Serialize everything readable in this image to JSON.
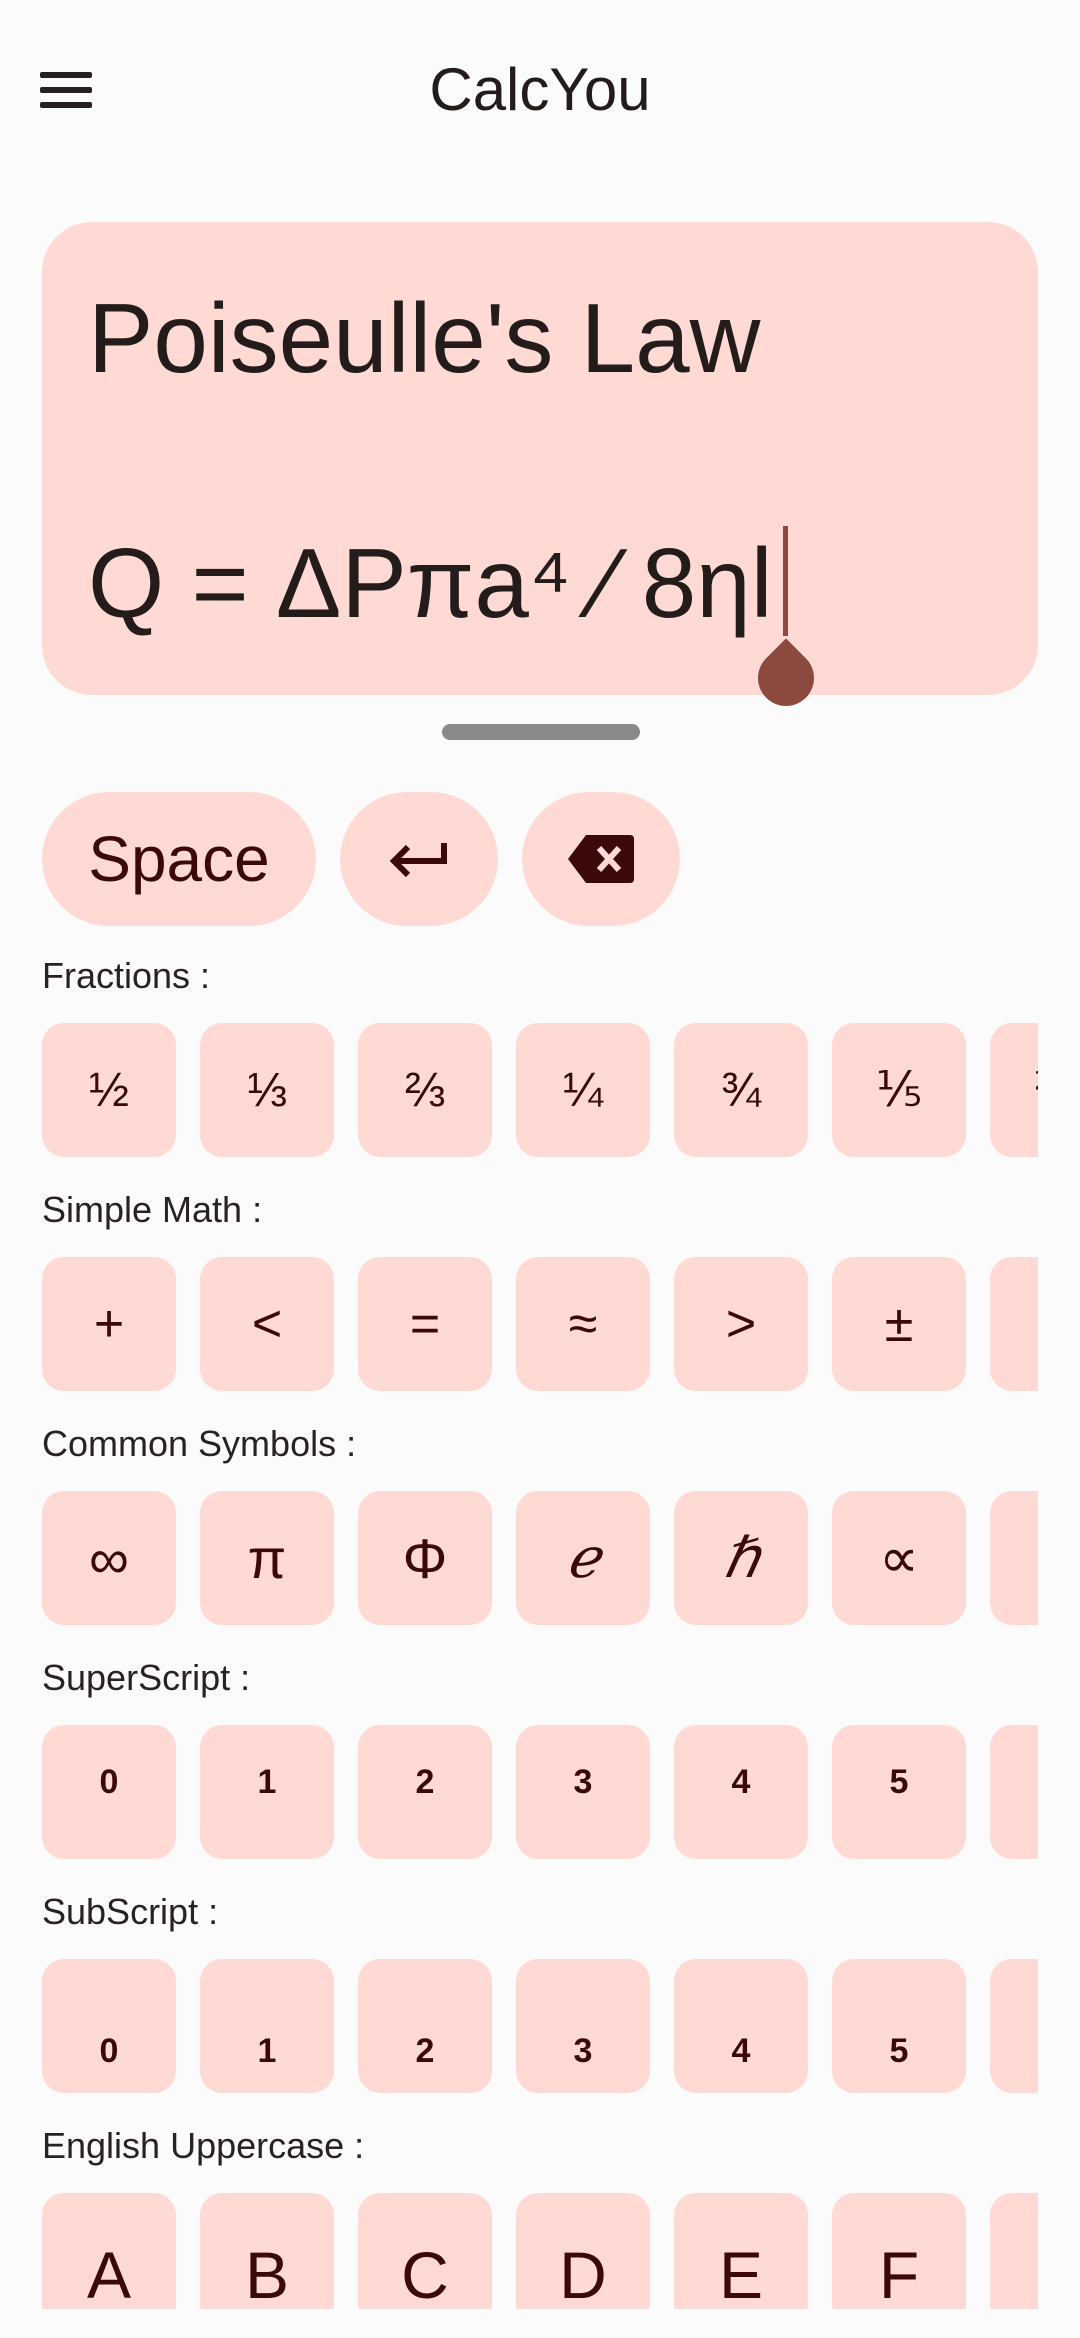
{
  "app": {
    "title": "CalcYou",
    "menu_icon": "hamburger-menu-icon"
  },
  "display": {
    "title_line": "Poiseulle's Law",
    "formula_line": "Q = ΔPπa⁴ ⁄ 8ηl"
  },
  "actions": {
    "space_label": "Space",
    "enter_icon": "enter-return-icon",
    "backspace_icon": "backspace-icon"
  },
  "sections": {
    "fractions": {
      "label": "Fractions :",
      "keys": [
        "½",
        "⅓",
        "⅔",
        "¼",
        "¾",
        "⅕",
        "⅖"
      ]
    },
    "simple_math": {
      "label": "Simple Math :",
      "keys": [
        "+",
        "<",
        "=",
        "≈",
        ">",
        "±",
        ""
      ]
    },
    "common_symbols": {
      "label": "Common Symbols :",
      "keys": [
        "∞",
        "π",
        "Φ",
        "ℯ",
        "ℏ",
        "∝",
        ""
      ]
    },
    "superscript": {
      "label": "SuperScript :",
      "keys": [
        "0",
        "1",
        "2",
        "3",
        "4",
        "5",
        ""
      ]
    },
    "subscript": {
      "label": "SubScript :",
      "keys": [
        "0",
        "1",
        "2",
        "3",
        "4",
        "5",
        ""
      ]
    },
    "english_uppercase": {
      "label": "English Uppercase :",
      "keys": [
        "A",
        "B",
        "C",
        "D",
        "E",
        "F",
        ""
      ]
    }
  },
  "colors": {
    "background": "#fcfbfb",
    "key_fill": "#ffdad4",
    "key_text": "#3b0909",
    "cursor": "#8c4a3f",
    "handle": "#8a8a8a"
  }
}
